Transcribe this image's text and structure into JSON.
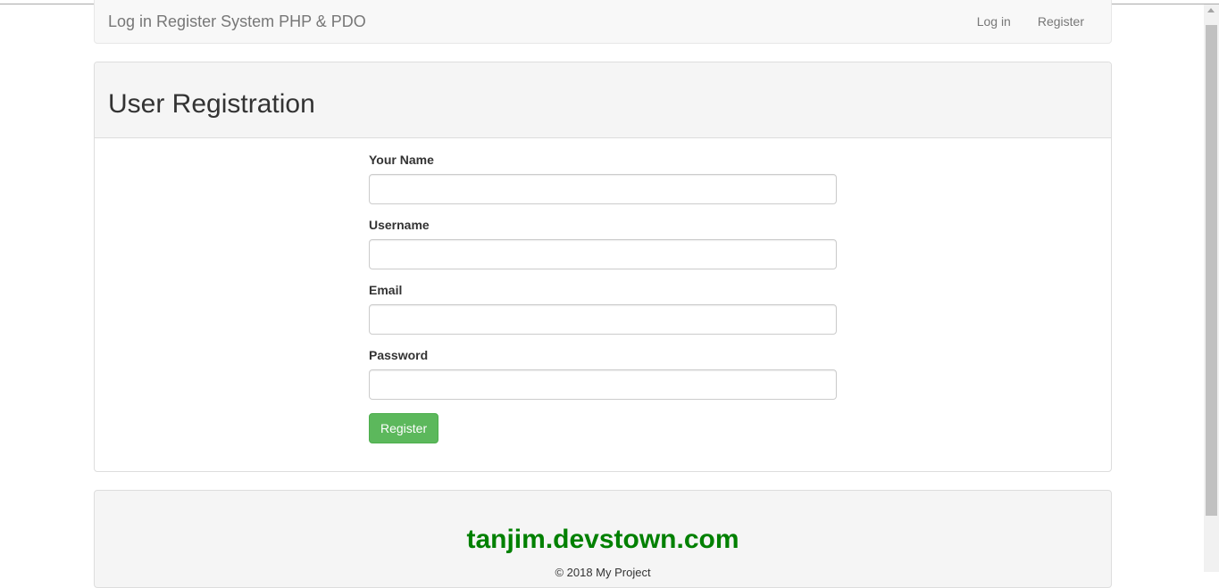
{
  "navbar": {
    "brand": "Log in Register System PHP & PDO",
    "links": [
      "Log in",
      "Register"
    ]
  },
  "panel": {
    "title": "User Registration",
    "fields": [
      {
        "label": "Your Name",
        "value": "",
        "placeholder": ""
      },
      {
        "label": "Username",
        "value": "",
        "placeholder": ""
      },
      {
        "label": "Email",
        "value": "",
        "placeholder": ""
      },
      {
        "label": "Password",
        "value": "",
        "placeholder": ""
      }
    ],
    "submit_label": "Register"
  },
  "footer": {
    "site": "tanjim.devstown.com",
    "copyright": "© 2018 My Project"
  },
  "colors": {
    "accent_button": "#5cb85c",
    "footer_site": "#008000"
  }
}
